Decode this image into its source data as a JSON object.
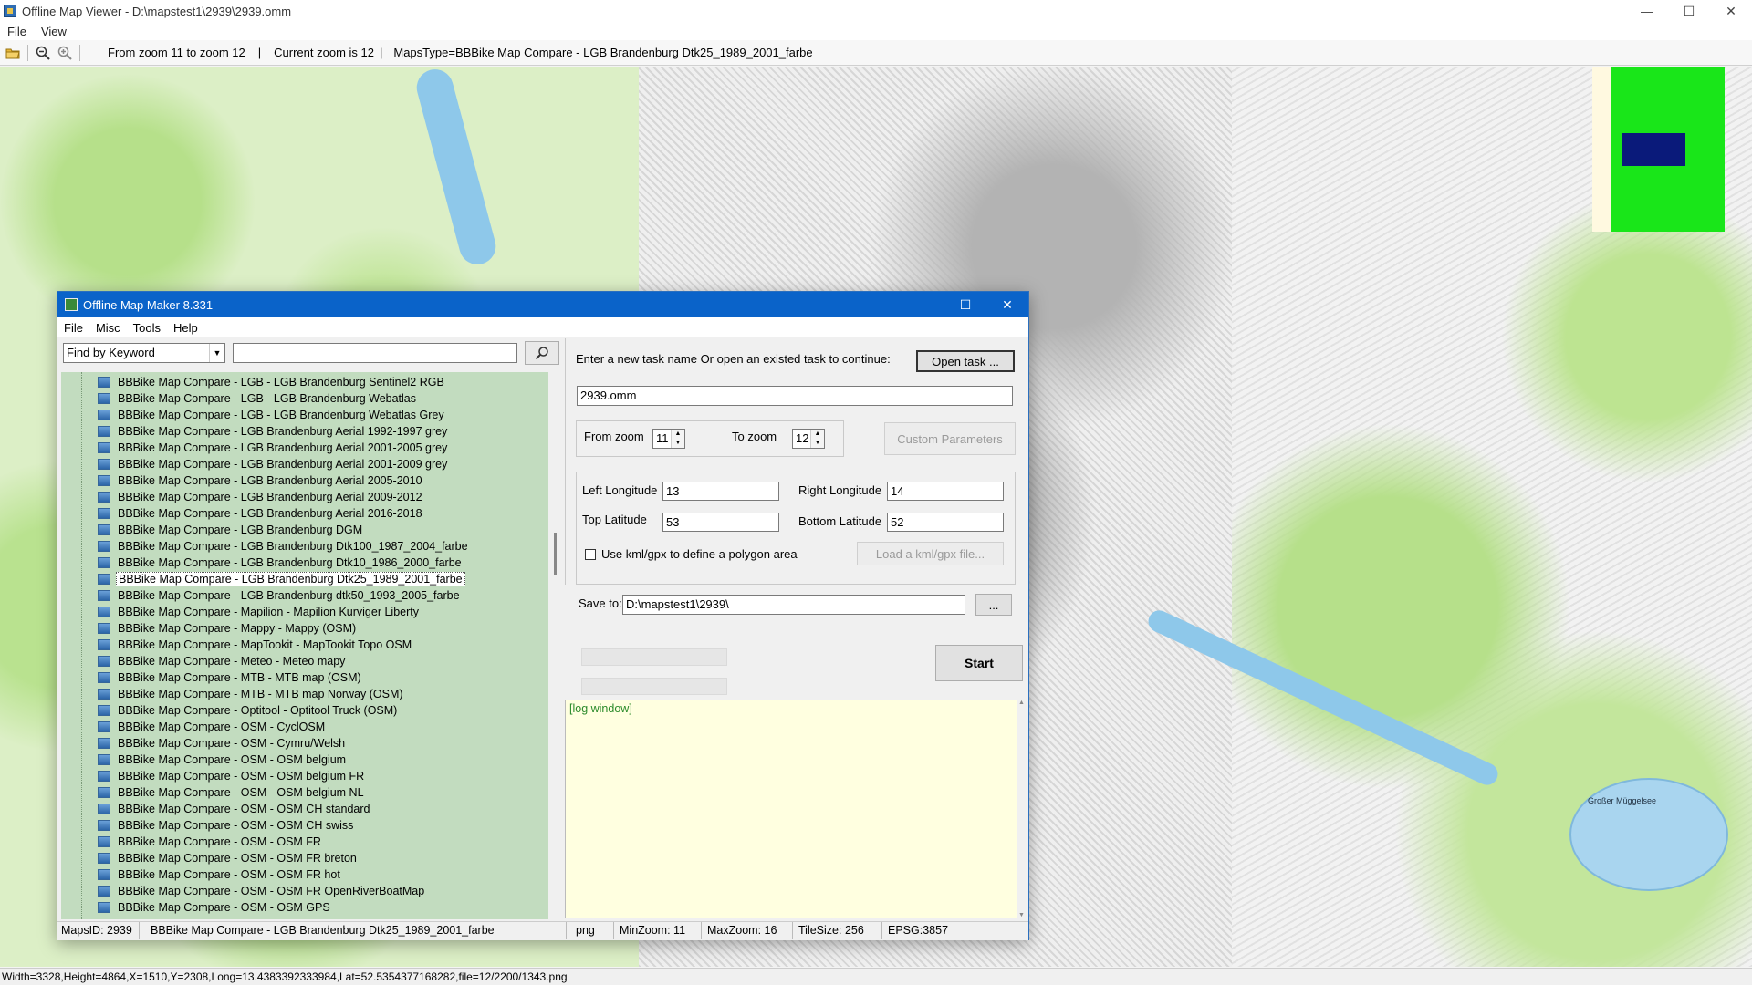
{
  "window": {
    "title": "Offline Map Viewer - D:\\mapstest1\\2939\\2939.omm",
    "menu": [
      "File",
      "View"
    ],
    "controls": {
      "minimize": "—",
      "maximize": "☐",
      "close": "✕"
    }
  },
  "toolbar": {
    "zoom_range": "From zoom 11 to zoom 12",
    "current_zoom": "Current zoom is 12",
    "maps_type": "MapsType=BBBike Map Compare - LGB Brandenburg Dtk25_1989_2001_farbe"
  },
  "status_bar": "Width=3328,Height=4864,X=1510,Y=2308,Long=13.4383392333984,Lat=52.5354377168282,file=12/2200/1343.png",
  "map": {
    "lake_label": "Großer Müggelsee",
    "overview_colors": {
      "background": "#19e619",
      "viewport": "#0a1a7a"
    }
  },
  "dialog": {
    "title": "Offline Map Maker 8.331",
    "controls": {
      "minimize": "—",
      "maximize": "☐",
      "close": "✕"
    },
    "menu": [
      "File",
      "Misc",
      "Tools",
      "Help"
    ],
    "search": {
      "mode": "Find by Keyword",
      "value": ""
    },
    "tree_items": [
      "BBBike Map Compare - LGB - LGB Brandenburg Sentinel2 RGB",
      "BBBike Map Compare - LGB - LGB Brandenburg Webatlas",
      "BBBike Map Compare - LGB - LGB Brandenburg Webatlas Grey",
      "BBBike Map Compare - LGB Brandenburg Aerial 1992-1997 grey",
      "BBBike Map Compare - LGB Brandenburg Aerial 2001-2005 grey",
      "BBBike Map Compare - LGB Brandenburg Aerial 2001-2009 grey",
      "BBBike Map Compare - LGB Brandenburg Aerial 2005-2010",
      "BBBike Map Compare - LGB Brandenburg Aerial 2009-2012",
      "BBBike Map Compare - LGB Brandenburg Aerial 2016-2018",
      "BBBike Map Compare - LGB Brandenburg DGM",
      "BBBike Map Compare - LGB Brandenburg Dtk100_1987_2004_farbe",
      "BBBike Map Compare - LGB Brandenburg Dtk10_1986_2000_farbe",
      "BBBike Map Compare - LGB Brandenburg Dtk25_1989_2001_farbe",
      "BBBike Map Compare - LGB Brandenburg dtk50_1993_2005_farbe",
      "BBBike Map Compare - Mapilion - Mapilion Kurviger Liberty",
      "BBBike Map Compare - Mappy - Mappy (OSM)",
      "BBBike Map Compare - MapTookit - MapTookit Topo OSM",
      "BBBike Map Compare - Meteo - Meteo mapy",
      "BBBike Map Compare - MTB - MTB map (OSM)",
      "BBBike Map Compare - MTB - MTB map Norway (OSM)",
      "BBBike Map Compare - Optitool - Optitool Truck (OSM)",
      "BBBike Map Compare - OSM - CyclOSM",
      "BBBike Map Compare - OSM - Cymru/Welsh",
      "BBBike Map Compare - OSM - OSM belgium",
      "BBBike Map Compare - OSM - OSM belgium FR",
      "BBBike Map Compare - OSM - OSM belgium NL",
      "BBBike Map Compare - OSM - OSM CH standard",
      "BBBike Map Compare - OSM - OSM CH swiss",
      "BBBike Map Compare - OSM - OSM FR",
      "BBBike Map Compare - OSM - OSM FR breton",
      "BBBike Map Compare - OSM - OSM FR hot",
      "BBBike Map Compare - OSM - OSM FR OpenRiverBoatMap",
      "BBBike Map Compare - OSM - OSM GPS"
    ],
    "selected_item": "BBBike Map Compare - LGB Brandenburg Dtk25_1989_2001_farbe",
    "task_prompt": "Enter a new task name Or open an existed task to continue:",
    "open_task_label": "Open task ...",
    "task_name": "2939.omm",
    "from_zoom_label": "From zoom",
    "from_zoom": "11",
    "to_zoom_label": "To zoom",
    "to_zoom": "12",
    "custom_params_label": "Custom Parameters",
    "left_lon_label": "Left Longitude",
    "left_lon": "13",
    "right_lon_label": "Right Longitude",
    "right_lon": "14",
    "top_lat_label": "Top Latitude",
    "top_lat": "53",
    "bottom_lat_label": "Bottom Latitude",
    "bottom_lat": "52",
    "kml_label": "Use kml/gpx to define a polygon area",
    "load_kml_label": "Load a kml/gpx file...",
    "save_to_label": "Save to:",
    "save_to": "D:\\mapstest1\\2939\\",
    "browse_label": "...",
    "start_label": "Start",
    "log_text": "[log window]",
    "status": {
      "maps_id": "MapsID: 2939",
      "maps_name": "BBBike Map Compare - LGB Brandenburg Dtk25_1989_2001_farbe",
      "format": "png",
      "min_zoom": "MinZoom: 11",
      "max_zoom": "MaxZoom: 16",
      "tile_size": "TileSize: 256",
      "epsg": "EPSG:3857"
    }
  }
}
